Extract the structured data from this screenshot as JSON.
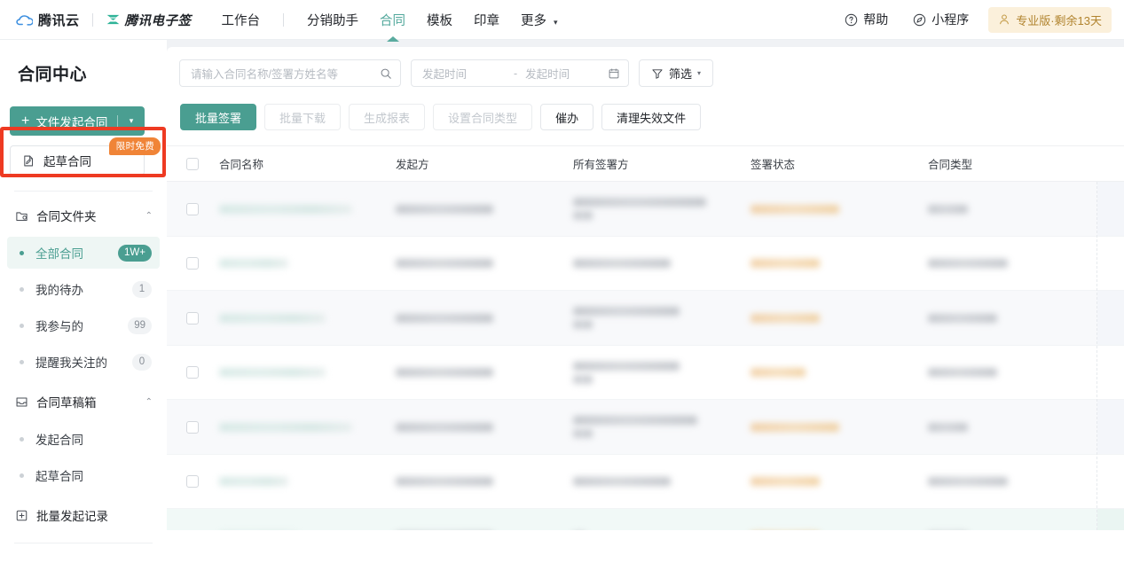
{
  "topnav": {
    "brand_cloud": "腾讯云",
    "brand_product": "腾讯电子签",
    "links": [
      {
        "label": "工作台",
        "active": false
      },
      {
        "label": "分销助手",
        "active": false
      },
      {
        "label": "合同",
        "active": true
      },
      {
        "label": "模板",
        "active": false
      },
      {
        "label": "印章",
        "active": false
      },
      {
        "label": "更多",
        "active": false,
        "caret": "▾"
      }
    ],
    "help_label": "帮助",
    "miniprogram_label": "小程序",
    "pro_badge": "专业版·剩余13天"
  },
  "sidebar": {
    "title": "合同中心",
    "primary_button": {
      "plus": "+",
      "label": "文件发起合同",
      "caret": "▾"
    },
    "draft_button": {
      "label": "起草合同",
      "tag": "限时免费"
    },
    "folder_group": {
      "label": "合同文件夹",
      "caret": "⌃"
    },
    "folder_items": [
      {
        "label": "全部合同",
        "badge": "1W+",
        "active": true
      },
      {
        "label": "我的待办",
        "badge": "1",
        "active": false
      },
      {
        "label": "我参与的",
        "badge": "99",
        "active": false
      },
      {
        "label": "提醒我关注的",
        "badge": "0",
        "active": false
      }
    ],
    "draftbox_group": {
      "label": "合同草稿箱",
      "caret": "⌃"
    },
    "draftbox_items": [
      {
        "label": "发起合同"
      },
      {
        "label": "起草合同"
      }
    ],
    "batch_record": {
      "label": "批量发起记录"
    }
  },
  "toolbar": {
    "search_placeholder": "请输入合同名称/签署方姓名等",
    "search_value": "",
    "date_from_placeholder": "发起时间",
    "date_to_placeholder": "发起时间",
    "date_dash": "-",
    "filter_label": "筛选",
    "filter_caret": "▾"
  },
  "actions": [
    {
      "label": "批量签署",
      "state": "primary"
    },
    {
      "label": "批量下载",
      "state": "disabled"
    },
    {
      "label": "生成报表",
      "state": "disabled"
    },
    {
      "label": "设置合同类型",
      "state": "disabled"
    },
    {
      "label": "催办",
      "state": "normal"
    },
    {
      "label": "清理失效文件",
      "state": "normal"
    }
  ],
  "table": {
    "columns": [
      {
        "key": "name",
        "label": "合同名称"
      },
      {
        "key": "initiator",
        "label": "发起方"
      },
      {
        "key": "signers",
        "label": "所有签署方"
      },
      {
        "key": "status",
        "label": "签署状态"
      },
      {
        "key": "type",
        "label": "合同类型"
      }
    ],
    "rows_redacted": true,
    "rows": [
      {
        "variant": "tall",
        "tint": "striped",
        "name_lines": [
          150
        ],
        "initiator_lines": [
          110
        ],
        "signers_lines": [
          150,
          22
        ],
        "status_lines": [
          100
        ],
        "type_lines": [
          45
        ]
      },
      {
        "variant": "short",
        "tint": "white",
        "name_lines": [
          78
        ],
        "initiator_lines": [
          110
        ],
        "signers_lines": [
          110
        ],
        "status_lines": [
          78
        ],
        "type_lines": [
          90
        ]
      },
      {
        "variant": "tall",
        "tint": "striped",
        "name_lines": [
          120
        ],
        "initiator_lines": [
          110
        ],
        "signers_lines": [
          120,
          22
        ],
        "status_lines": [
          78
        ],
        "type_lines": [
          78
        ]
      },
      {
        "variant": "short",
        "tint": "white",
        "name_lines": [
          130
        ],
        "initiator_lines": [
          110
        ],
        "signers_lines": [
          130,
          22
        ],
        "status_lines": [
          62
        ],
        "type_lines": [
          78
        ]
      },
      {
        "variant": "tall",
        "tint": "striped",
        "name_lines": [
          150
        ],
        "initiator_lines": [
          110
        ],
        "signers_lines": [
          140,
          22
        ],
        "status_lines": [
          100
        ],
        "type_lines": [
          45
        ]
      },
      {
        "variant": "short",
        "tint": "white",
        "name_lines": [
          78
        ],
        "initiator_lines": [
          110
        ],
        "signers_lines": [
          110
        ],
        "status_lines": [
          78
        ],
        "type_lines": [
          90
        ]
      },
      {
        "variant": "tall",
        "tint": "hover",
        "name_lines": [
          90
        ],
        "initiator_lines": [
          110
        ],
        "signers_lines": [
          14
        ],
        "status_lines": [
          78
        ],
        "type_lines": [
          45
        ]
      }
    ]
  },
  "colors": {
    "brand_teal": "#4a9e91",
    "accent_orange": "#f08437",
    "annotation_red": "#ee3a22",
    "badge_gold": "#b1842f",
    "page_bg": "#f0f2f5"
  }
}
